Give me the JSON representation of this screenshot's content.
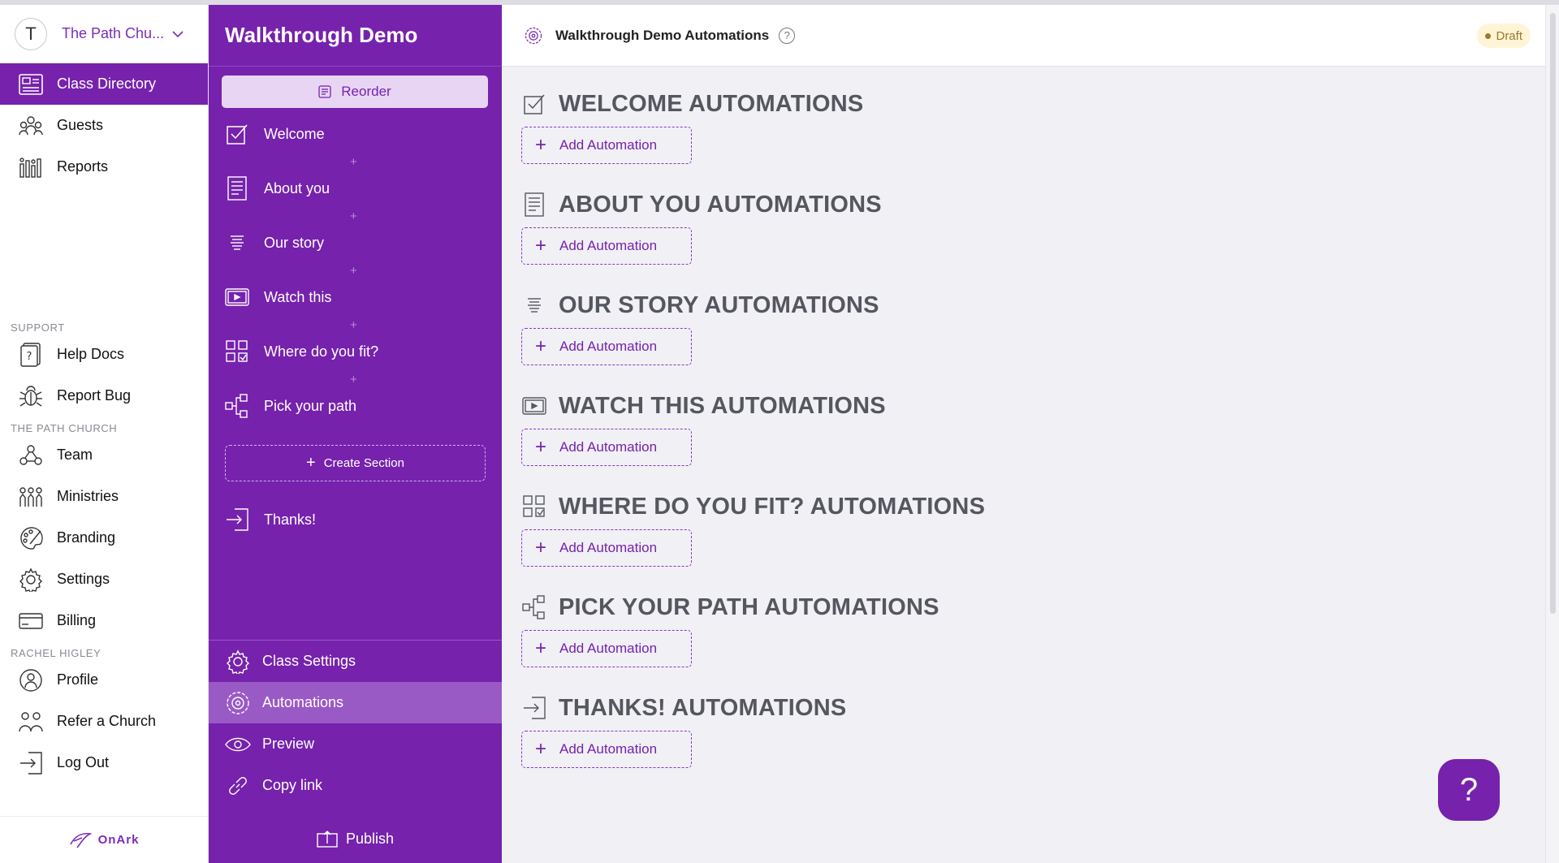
{
  "org": {
    "avatar_letter": "T",
    "name": "The Path Chu..."
  },
  "leftnav": {
    "main_items": [
      {
        "label": "Class Directory",
        "icon": "class-directory-icon"
      },
      {
        "label": "Guests",
        "icon": "guests-icon"
      },
      {
        "label": "Reports",
        "icon": "reports-icon"
      }
    ],
    "support_label": "SUPPORT",
    "support_items": [
      {
        "label": "Help Docs",
        "icon": "help-docs-icon"
      },
      {
        "label": "Report Bug",
        "icon": "bug-icon"
      }
    ],
    "church_label": "THE PATH CHURCH",
    "church_items": [
      {
        "label": "Team",
        "icon": "team-icon"
      },
      {
        "label": "Ministries",
        "icon": "ministries-icon"
      },
      {
        "label": "Branding",
        "icon": "palette-icon"
      },
      {
        "label": "Settings",
        "icon": "gear-icon"
      },
      {
        "label": "Billing",
        "icon": "credit-card-icon"
      }
    ],
    "user_label": "RACHEL HIGLEY",
    "user_items": [
      {
        "label": "Profile",
        "icon": "profile-icon"
      },
      {
        "label": "Refer a Church",
        "icon": "refer-icon"
      },
      {
        "label": "Log Out",
        "icon": "logout-icon"
      }
    ],
    "footer_brand": "OnArk"
  },
  "panel": {
    "title": "Walkthrough Demo",
    "reorder_label": "Reorder",
    "sections": [
      {
        "label": "Welcome",
        "icon": "checkbox-icon"
      },
      {
        "label": "About you",
        "icon": "form-icon"
      },
      {
        "label": "Our story",
        "icon": "text-icon"
      },
      {
        "label": "Watch this",
        "icon": "video-icon"
      },
      {
        "label": "Where do you fit?",
        "icon": "grid-check-icon"
      },
      {
        "label": "Pick your path",
        "icon": "flow-icon"
      }
    ],
    "plus_glyph": "+",
    "create_section_label": "Create Section",
    "thanks_label": "Thanks!",
    "bottom_items": [
      {
        "label": "Class Settings",
        "icon": "gear-icon"
      },
      {
        "label": "Automations",
        "icon": "automation-icon"
      },
      {
        "label": "Preview",
        "icon": "eye-icon"
      },
      {
        "label": "Copy link",
        "icon": "link-icon"
      }
    ],
    "publish_label": "Publish"
  },
  "main": {
    "title": "Walkthrough Demo Automations",
    "help_glyph": "?",
    "status": "Draft",
    "add_label": "Add Automation",
    "groups": [
      {
        "title": "WELCOME AUTOMATIONS",
        "icon": "checkbox-icon"
      },
      {
        "title": "ABOUT YOU AUTOMATIONS",
        "icon": "form-icon"
      },
      {
        "title": "OUR STORY AUTOMATIONS",
        "icon": "text-icon"
      },
      {
        "title": "WATCH THIS AUTOMATIONS",
        "icon": "video-icon"
      },
      {
        "title": "WHERE DO YOU FIT? AUTOMATIONS",
        "icon": "grid-check-icon"
      },
      {
        "title": "PICK YOUR PATH AUTOMATIONS",
        "icon": "flow-icon"
      },
      {
        "title": "THANKS! AUTOMATIONS",
        "icon": "exit-icon"
      }
    ]
  },
  "fab": {
    "glyph": "?"
  },
  "colors": {
    "brand_purple": "#7622ad",
    "active_item": "#9a5ac6",
    "draft_bg": "#fff4d6"
  }
}
